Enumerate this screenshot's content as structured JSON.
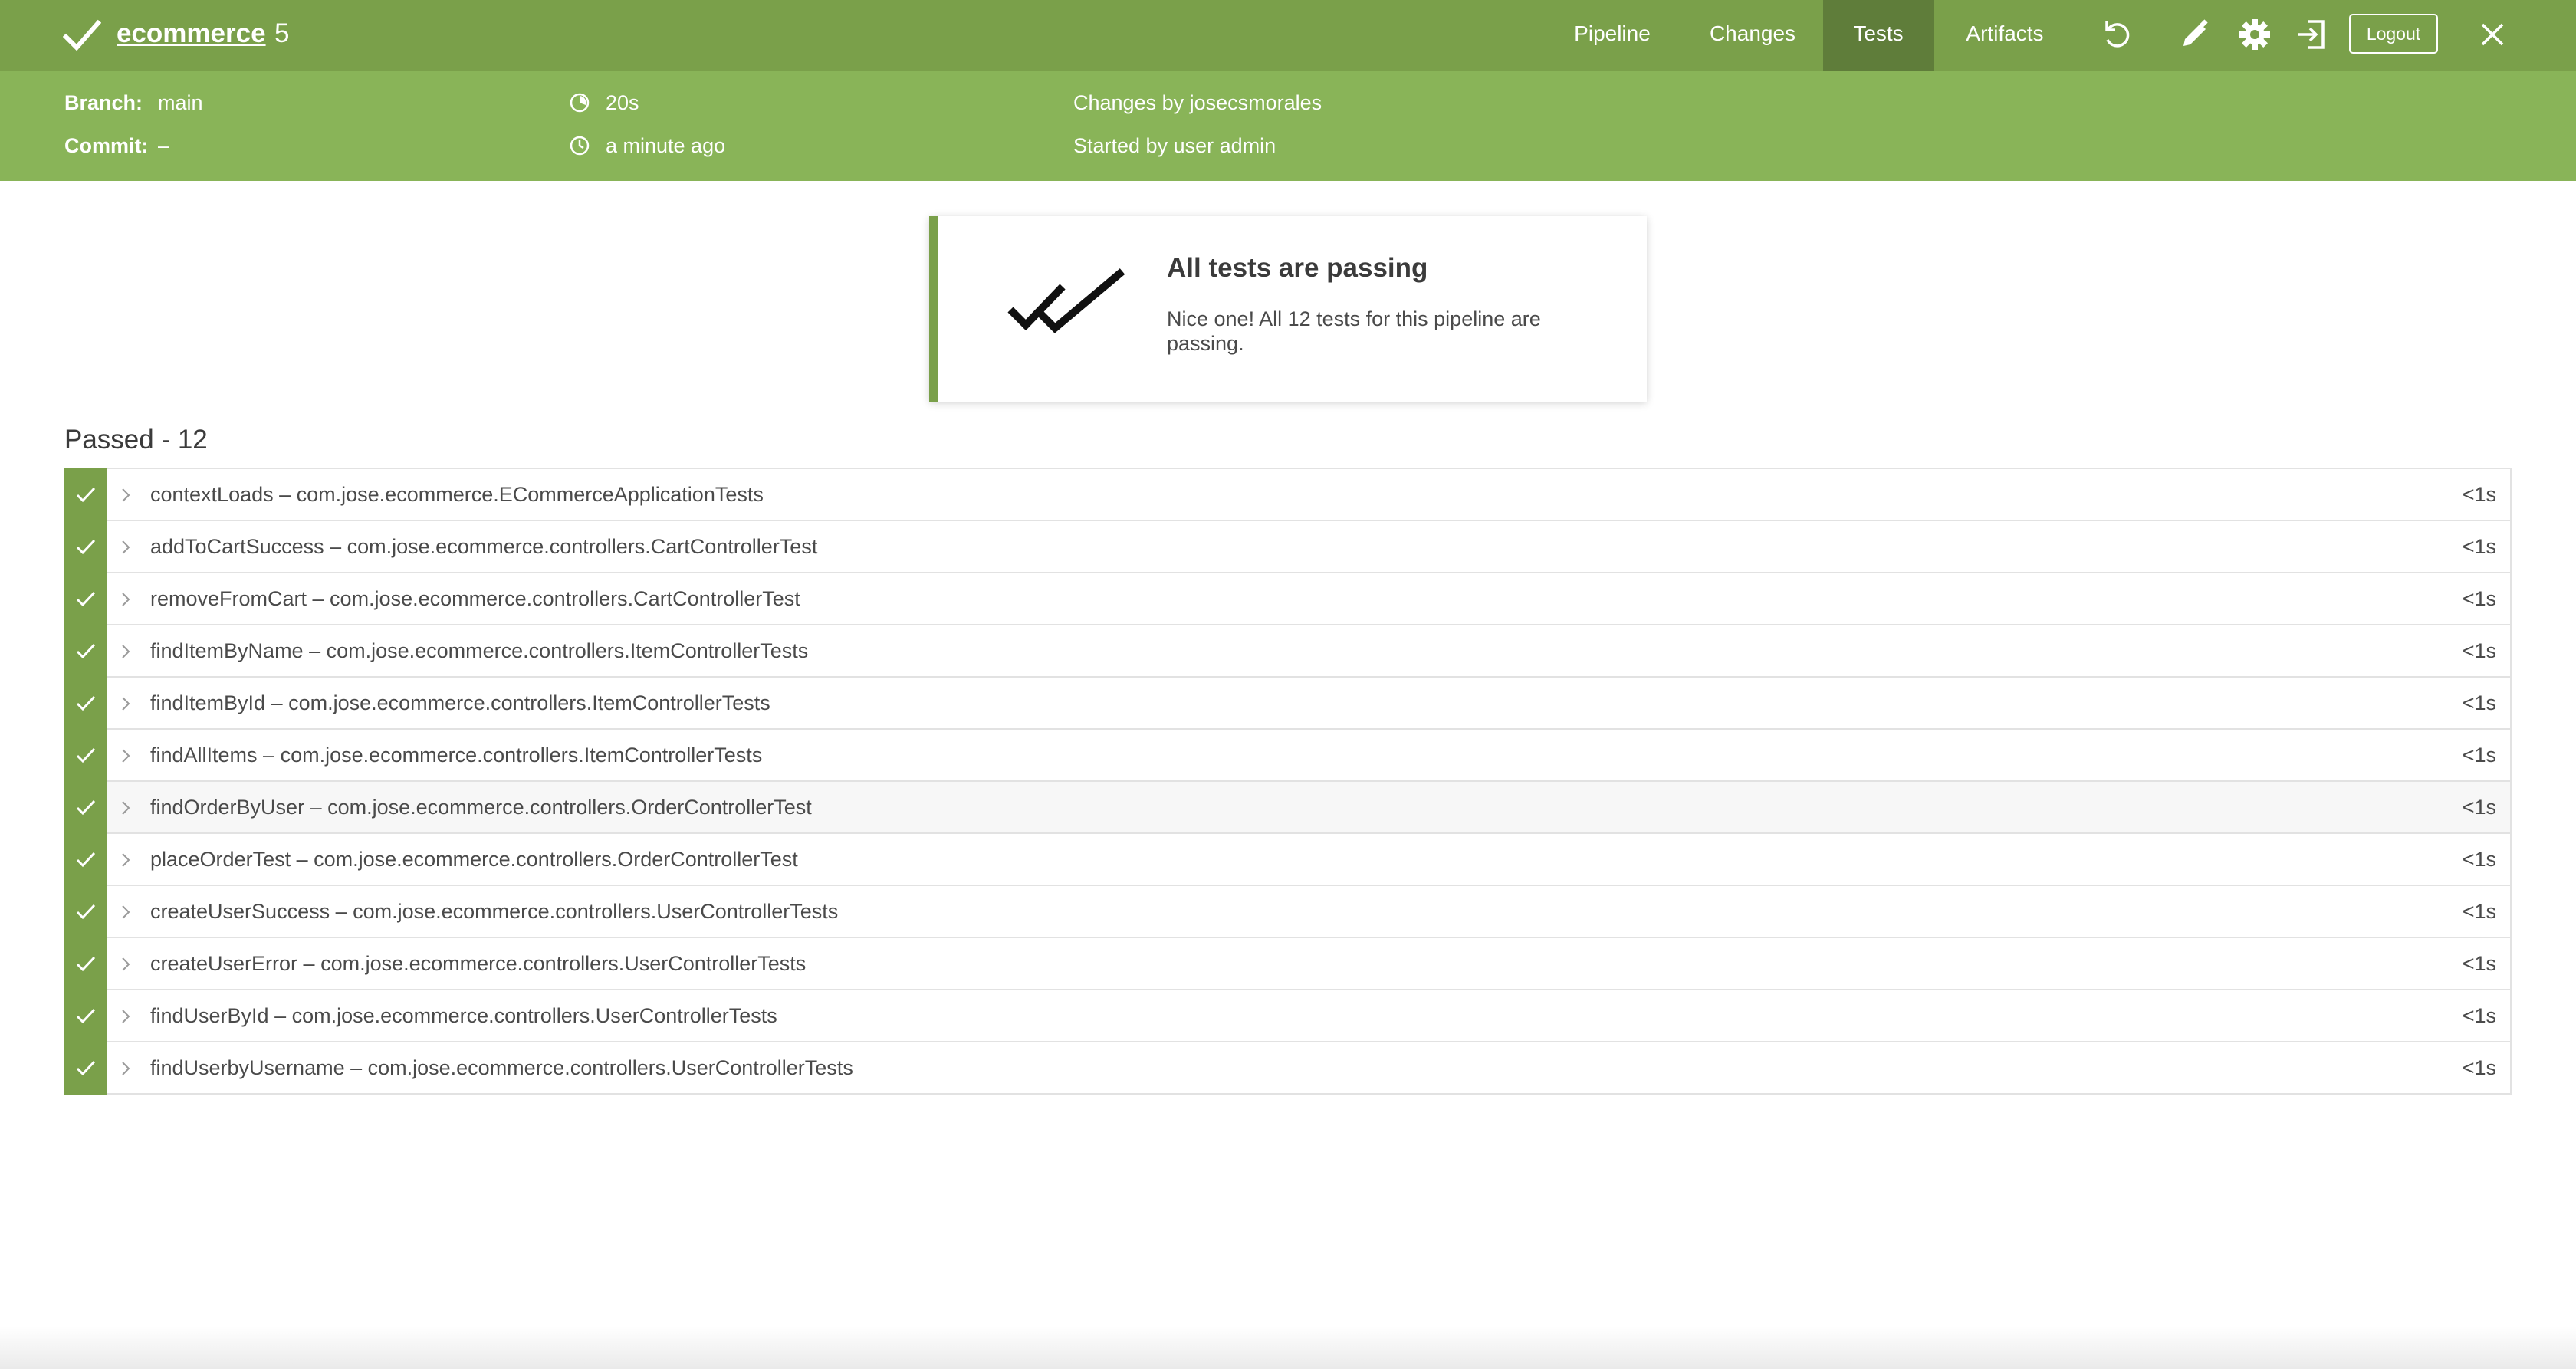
{
  "header": {
    "pipeline_name": "ecommerce",
    "run_number": "5",
    "tabs": [
      {
        "label": "Pipeline",
        "active": false
      },
      {
        "label": "Changes",
        "active": false
      },
      {
        "label": "Tests",
        "active": true
      },
      {
        "label": "Artifacts",
        "active": false
      }
    ],
    "logout_label": "Logout",
    "icons": [
      "check-icon",
      "rerun-icon",
      "edit-icon",
      "gear-icon",
      "sign-in-icon",
      "close-icon"
    ]
  },
  "run_info": {
    "branch_label": "Branch:",
    "branch_value": "main",
    "commit_label": "Commit:",
    "commit_value": "–",
    "duration": "20s",
    "time_ago": "a minute ago",
    "changes_by": "Changes by josecsmorales",
    "started_by": "Started by user admin"
  },
  "banner": {
    "title": "All tests are passing",
    "message": "Nice one! All 12 tests for this pipeline are passing."
  },
  "tests": {
    "heading": "Passed - 12",
    "rows": [
      {
        "name": "contextLoads – com.jose.ecommerce.ECommerceApplicationTests",
        "duration": "<1s"
      },
      {
        "name": "addToCartSuccess – com.jose.ecommerce.controllers.CartControllerTest",
        "duration": "<1s"
      },
      {
        "name": "removeFromCart – com.jose.ecommerce.controllers.CartControllerTest",
        "duration": "<1s"
      },
      {
        "name": "findItemByName – com.jose.ecommerce.controllers.ItemControllerTests",
        "duration": "<1s"
      },
      {
        "name": "findItemById – com.jose.ecommerce.controllers.ItemControllerTests",
        "duration": "<1s"
      },
      {
        "name": "findAllItems – com.jose.ecommerce.controllers.ItemControllerTests",
        "duration": "<1s"
      },
      {
        "name": "findOrderByUser – com.jose.ecommerce.controllers.OrderControllerTest",
        "duration": "<1s"
      },
      {
        "name": "placeOrderTest – com.jose.ecommerce.controllers.OrderControllerTest",
        "duration": "<1s"
      },
      {
        "name": "createUserSuccess – com.jose.ecommerce.controllers.UserControllerTests",
        "duration": "<1s"
      },
      {
        "name": "createUserError – com.jose.ecommerce.controllers.UserControllerTests",
        "duration": "<1s"
      },
      {
        "name": "findUserById – com.jose.ecommerce.controllers.UserControllerTests",
        "duration": "<1s"
      },
      {
        "name": "findUserbyUsername – com.jose.ecommerce.controllers.UserControllerTests",
        "duration": "<1s"
      }
    ]
  },
  "colors": {
    "header_bg": "#7aa04a",
    "subheader_bg": "#89b458",
    "active_tab_bg": "#5f7d3a",
    "pass_green": "#7aa04a"
  }
}
